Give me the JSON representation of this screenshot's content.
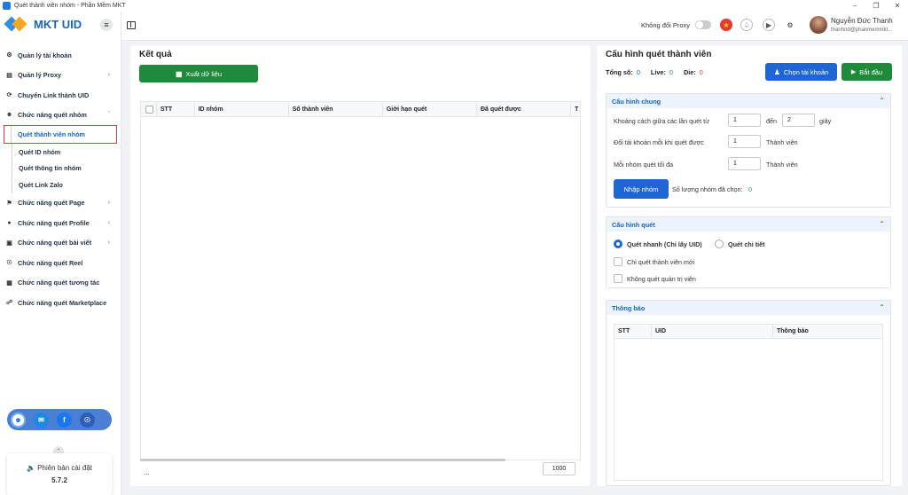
{
  "window": {
    "title": "Quét thành viên nhóm - Phần Mềm MKT"
  },
  "sidebar": {
    "logo_text": "MKT UID",
    "items": [
      {
        "label": "Quản lý tài khoản"
      },
      {
        "label": "Quản lý Proxy"
      },
      {
        "label": "Chuyển Link thành UID"
      },
      {
        "label": "Chức năng quét nhóm"
      },
      {
        "label": "Chức năng quét Page"
      },
      {
        "label": "Chức năng quét Profile"
      },
      {
        "label": "Chức năng quét bài viết"
      },
      {
        "label": "Chức năng quét Reel"
      },
      {
        "label": "Chức năng quét tương tác"
      },
      {
        "label": "Chức năng quét Marketplace"
      }
    ],
    "subitems": [
      {
        "label": "Quét thành viên nhóm"
      },
      {
        "label": "Quét ID nhóm"
      },
      {
        "label": "Quét thông tin nhóm"
      },
      {
        "label": "Quét Link Zalo"
      }
    ],
    "version_label": "Phiên bản cài đặt",
    "version": "5.7.2"
  },
  "topbar": {
    "proxy_label": "Không đổi Proxy",
    "user_name": "Nguyễn Đức Thanh",
    "user_email": "thanhnd@phanmemmkt..."
  },
  "results": {
    "title": "Kết quả",
    "export_label": "Xuất dữ liệu",
    "columns": [
      "STT",
      "ID nhóm",
      "Số thành viên",
      "Giới hạn quét",
      "Đã quét được",
      "T"
    ],
    "footer_ellipsis": "...",
    "page_size": "1000"
  },
  "config": {
    "title": "Cấu hình quét thành viên",
    "total_label": "Tổng số:",
    "total": "0",
    "live_label": "Live:",
    "live": "0",
    "die_label": "Die:",
    "die": "0",
    "choose_account": "Chọn tài khoản",
    "start": "Bắt đầu",
    "general": {
      "title": "Cấu hình chung",
      "delay_label": "Khoảng cách giữa các lần quét từ",
      "delay_from": "1",
      "delay_to_label": "đến",
      "delay_to": "2",
      "delay_unit": "giây",
      "switch_label": "Đổi tài khoản mỗi khi quét được",
      "switch_value": "1",
      "switch_unit": "Thành viên",
      "max_label": "Mỗi nhóm quét tối đa",
      "max_value": "1",
      "max_unit": "Thành viên",
      "import_label": "Nhập nhóm",
      "selected_label": "Số lượng nhóm đã chọn:",
      "selected_count": "0"
    },
    "scan": {
      "title": "Cấu hình quét",
      "fast": "Quét nhanh (Chỉ lấy UID)",
      "detail": "Quét chi tiết",
      "new_only": "Chỉ quét thành viên mới",
      "no_admin": "Không quét quản trị viên"
    },
    "notify": {
      "title": "Thông báo",
      "columns": [
        "STT",
        "UID",
        "Thông báo"
      ]
    }
  },
  "colors": {
    "accent": "#1e66d6",
    "green": "#1f8a3b",
    "live": "#1f9d55",
    "die": "#e53935",
    "total": "#1565c0"
  }
}
